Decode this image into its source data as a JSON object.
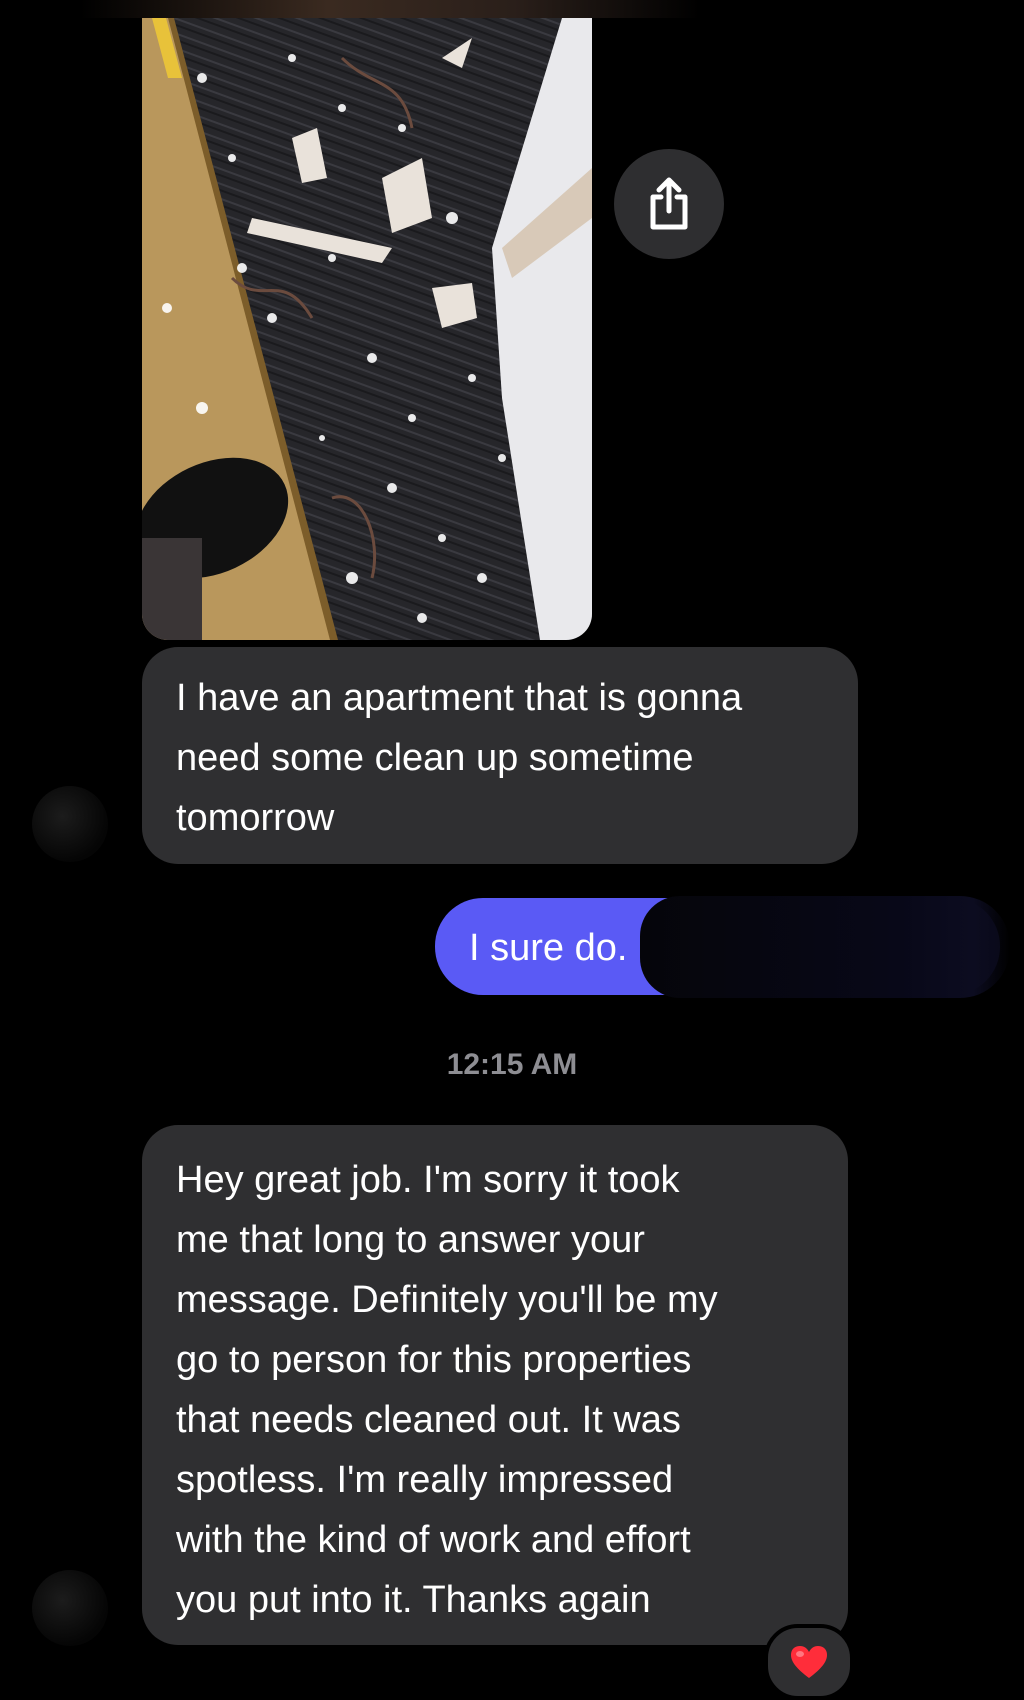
{
  "conversation": {
    "messages": [
      {
        "type": "image",
        "direction": "incoming",
        "alt": ""
      },
      {
        "type": "text",
        "direction": "incoming",
        "text": "I have an apartment that is gonna\nneed some clean up sometime\ntomorrow"
      },
      {
        "type": "text",
        "direction": "outgoing",
        "text": "I sure do."
      },
      {
        "type": "timestamp",
        "text": "12:15 AM"
      },
      {
        "type": "text",
        "direction": "incoming",
        "text": "Hey great job. I'm sorry it took\nme that long to answer your\nmessage. Definitely you'll be my\ngo to person for this properties\nthat needs cleaned out. It was\nspotless. I'm really impressed\nwith the kind of work and effort\nyou put into it. Thanks again",
        "reaction": "❤️"
      }
    ]
  },
  "icons": {
    "share": "share-icon",
    "heart": "heart-reaction-icon"
  },
  "colors": {
    "background": "#000000",
    "incoming_bubble": "#2f2f31",
    "outgoing_bubble": "#5a5af5",
    "timestamp": "#8e8e93",
    "heart": "#ff2d3a"
  }
}
